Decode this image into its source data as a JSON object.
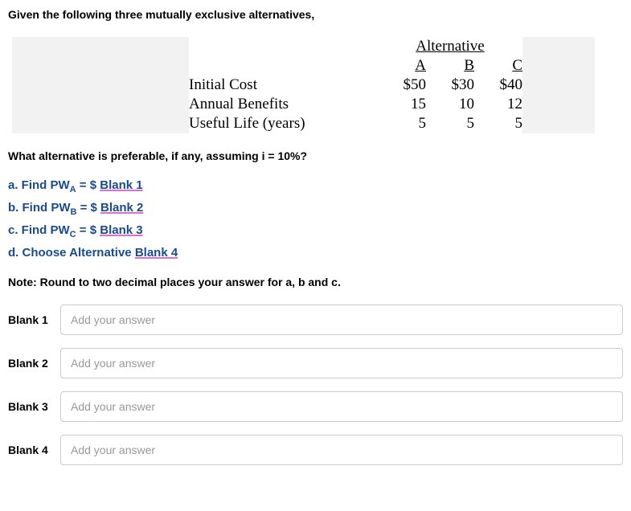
{
  "intro": "Given the following three mutually exclusive alternatives,",
  "table": {
    "super_header": "Alternative",
    "columns": [
      "A",
      "B",
      "C"
    ],
    "rows": [
      {
        "label": "Initial Cost",
        "values": [
          "$50",
          "$30",
          "$40"
        ]
      },
      {
        "label": "Annual Benefits",
        "values": [
          "15",
          "10",
          "12"
        ]
      },
      {
        "label": "Useful Life (years)",
        "values": [
          "5",
          "5",
          "5"
        ]
      }
    ]
  },
  "question": "What alternative is preferable, if any, assuming i = 10%?",
  "parts": {
    "a": {
      "prefix": "a. Find PW",
      "sub": "A",
      "mid": " = $ ",
      "blank": "Blank 1"
    },
    "b": {
      "prefix": "b. Find PW",
      "sub": "B",
      "mid": " = $ ",
      "blank": "Blank 2"
    },
    "c": {
      "prefix": "c. Find PW",
      "sub": "C",
      "mid": " = $ ",
      "blank": "Blank 3"
    },
    "d": {
      "prefix": "d. Choose Alternative ",
      "blank": "Blank 4"
    }
  },
  "note": "Note: Round to two decimal places your answer for a, b and c.",
  "answers": [
    {
      "label": "Blank 1",
      "placeholder": "Add your answer"
    },
    {
      "label": "Blank 2",
      "placeholder": "Add your answer"
    },
    {
      "label": "Blank 3",
      "placeholder": "Add your answer"
    },
    {
      "label": "Blank 4",
      "placeholder": "Add your answer"
    }
  ]
}
